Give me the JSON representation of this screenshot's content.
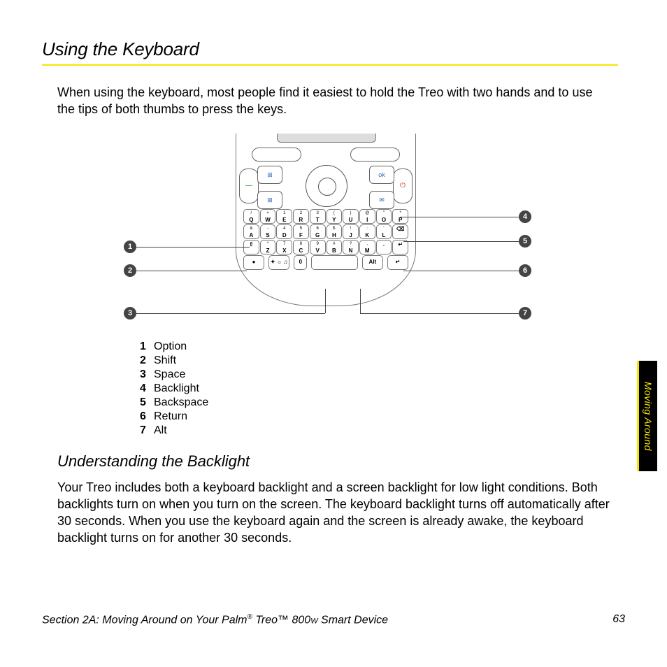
{
  "heading": "Using the Keyboard",
  "intro": "When using the keyboard, most people find it easiest to hold the Treo with two hands and to use the tips of both thumbs to press the keys.",
  "diagram": {
    "nav": {
      "n1": "⊞",
      "n2": "ok",
      "n3": "⊞",
      "n4": "✉",
      "dialL": "—",
      "dialR": "⏻"
    },
    "rows": [
      [
        {
          "s": "/",
          "m": "Q"
        },
        {
          "s": "+",
          "m": "W"
        },
        {
          "s": "1",
          "m": "E"
        },
        {
          "s": "2",
          "m": "R"
        },
        {
          "s": "3",
          "m": "T"
        },
        {
          "s": "(",
          "m": "Y"
        },
        {
          "s": ")",
          "m": "U"
        },
        {
          "s": "@",
          "m": "I"
        },
        {
          "s": "\"",
          "m": "O"
        },
        {
          "s": "*",
          "m": "P"
        }
      ],
      [
        {
          "s": "&",
          "m": "A"
        },
        {
          "s": "-",
          "m": "S"
        },
        {
          "s": "4",
          "m": "D"
        },
        {
          "s": "5",
          "m": "F"
        },
        {
          "s": "6",
          "m": "G"
        },
        {
          "s": "$",
          "m": "H"
        },
        {
          "s": "!",
          "m": "J"
        },
        {
          "s": ":",
          "m": "K"
        },
        {
          "s": "'",
          "m": "L"
        },
        {
          "s": "",
          "m": "⌫"
        }
      ],
      [
        {
          "s": "",
          "m": "⇧"
        },
        {
          "s": "*",
          "m": "Z"
        },
        {
          "s": "7",
          "m": "X"
        },
        {
          "s": "8",
          "m": "C"
        },
        {
          "s": "9",
          "m": "V"
        },
        {
          "s": "#",
          "m": "B"
        },
        {
          "s": "?",
          "m": "N"
        },
        {
          "s": ",",
          "m": "M"
        },
        {
          "s": "",
          "m": "."
        },
        {
          "s": "",
          "m": "↵"
        }
      ]
    ],
    "bottom": [
      {
        "m": "●",
        "cls": "wide"
      },
      {
        "m": "✦ ☼ ♫",
        "cls": "wide"
      },
      {
        "s": "",
        "m": "0"
      },
      {
        "m": "",
        "cls": "xwide"
      },
      {
        "m": "Alt",
        "cls": "wide"
      },
      {
        "m": "↵",
        "cls": "wide"
      }
    ],
    "callouts": {
      "c1": "1",
      "c2": "2",
      "c3": "3",
      "c4": "4",
      "c5": "5",
      "c6": "6",
      "c7": "7"
    }
  },
  "legend": [
    {
      "n": "1",
      "t": "Option"
    },
    {
      "n": "2",
      "t": "Shift"
    },
    {
      "n": "3",
      "t": "Space"
    },
    {
      "n": "4",
      "t": "Backlight"
    },
    {
      "n": "5",
      "t": "Backspace"
    },
    {
      "n": "6",
      "t": "Return"
    },
    {
      "n": "7",
      "t": "Alt"
    }
  ],
  "subheading": "Understanding the Backlight",
  "body2": "Your Treo includes both a keyboard backlight and a screen backlight for low light conditions. Both backlights turn on when you turn on the screen. The keyboard backlight turns off automatically after 30 seconds. When you use the keyboard again and the screen is already awake, the keyboard backlight turns on for another 30 seconds.",
  "sideTab": "Moving Around",
  "footer": {
    "left_a": "Section 2A: Moving Around on Your Palm",
    "reg": "®",
    "left_b": " Treo™ 800",
    "sub": "W",
    "left_c": " Smart Device",
    "page": "63"
  }
}
